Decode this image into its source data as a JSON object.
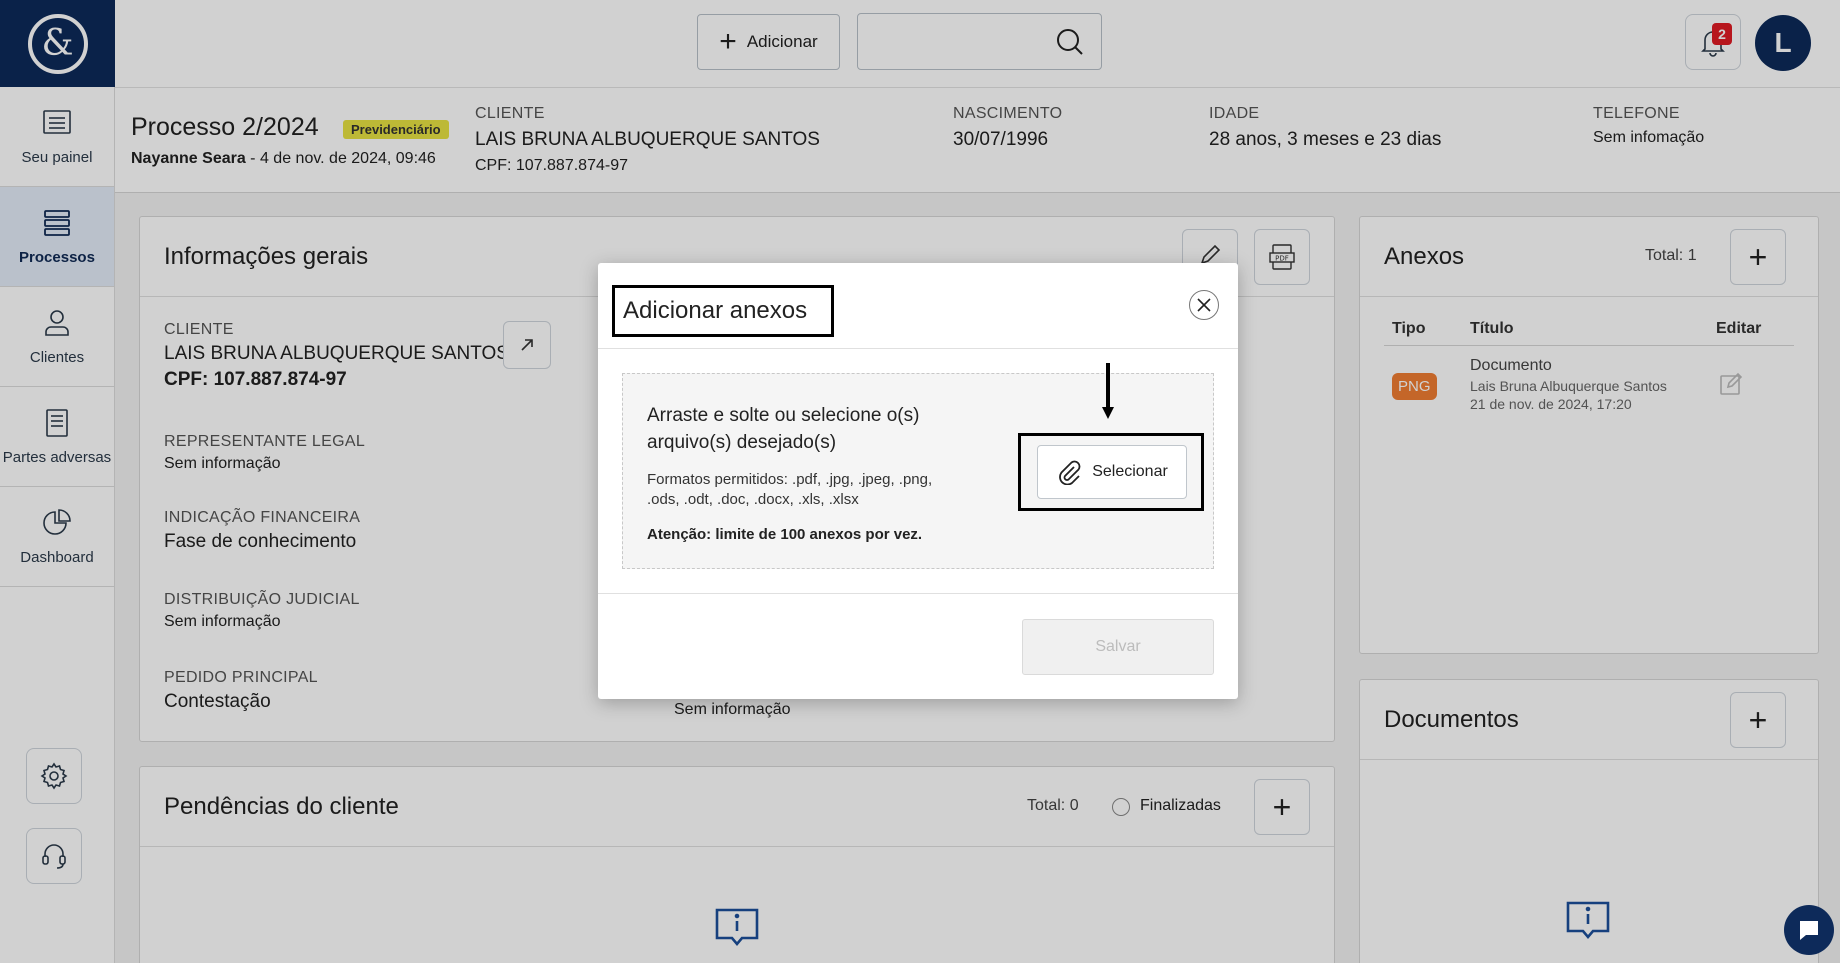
{
  "sidebar": {
    "items": [
      {
        "label": "Seu painel",
        "icon": "dashboard-list-icon"
      },
      {
        "label": "Processos",
        "icon": "stack-icon"
      },
      {
        "label": "Clientes",
        "icon": "user-icon"
      },
      {
        "label": "Partes adversas",
        "icon": "document-icon"
      },
      {
        "label": "Dashboard",
        "icon": "pie-chart-icon"
      }
    ]
  },
  "topbar": {
    "add_label": "Adicionar",
    "search_placeholder": "",
    "notification_count": "2",
    "avatar_initial": "L"
  },
  "process": {
    "title": "Processo 2/2024",
    "tag": "Previdenciário",
    "author": "Nayanne Seara",
    "date": " - 4 de nov. de 2024, 09:46",
    "client_label": "CLIENTE",
    "client_name": "LAIS BRUNA ALBUQUERQUE SANTOS",
    "client_cpf": "CPF: 107.887.874-97",
    "birth_label": "NASCIMENTO",
    "birth_value": "30/07/1996",
    "age_label": "IDADE",
    "age_value": "28 anos, 3 meses e 23 dias",
    "phone_label": "TELEFONE",
    "phone_value": "Sem infomação"
  },
  "general_info": {
    "title": "Informações gerais",
    "client_label": "CLIENTE",
    "client_name": "LAIS BRUNA ALBUQUERQUE SANTOS",
    "client_cpf": "CPF: 107.887.874-97",
    "legal_rep_label": "REPRESENTANTE LEGAL",
    "legal_rep_value": "Sem informação",
    "financial_label": "INDICAÇÃO FINANCEIRA",
    "financial_value": "Fase de conhecimento",
    "judicial_label": "DISTRIBUIÇÃO JUDICIAL",
    "judicial_value": "Sem informação",
    "main_request_label": "PEDIDO PRINCIPAL",
    "main_request_value": "Contestação",
    "hidden_value": "Sem informação"
  },
  "pending": {
    "title": "Pendências do cliente",
    "total": "Total: 0",
    "finalized_label": "Finalizadas"
  },
  "annexes": {
    "title": "Anexos",
    "total": "Total: 1",
    "col_type": "Tipo",
    "col_title": "Título",
    "col_edit": "Editar",
    "rows": [
      {
        "type": "PNG",
        "title": "Documento",
        "client": "Lais Bruna Albuquerque Santos",
        "date": "21 de nov. de 2024, 17:20"
      }
    ]
  },
  "documents": {
    "title": "Documentos"
  },
  "modal": {
    "title": "Adicionar anexos",
    "dropzone_title": "Arraste e solte ou selecione o(s) arquivo(s) desejado(s)",
    "formats": "Formatos permitidos: .pdf, .jpg, .jpeg, .png, .ods, .odt, .doc, .docx, .xls, .xlsx",
    "warning": "Atenção: limite de 100 anexos por vez.",
    "select_label": "Selecionar",
    "save_label": "Salvar"
  },
  "colors": {
    "brand_navy": "#0d2a5a",
    "tag_yellow": "#e7e243",
    "png_orange": "#f07d32",
    "badge_red": "#e01b24"
  }
}
